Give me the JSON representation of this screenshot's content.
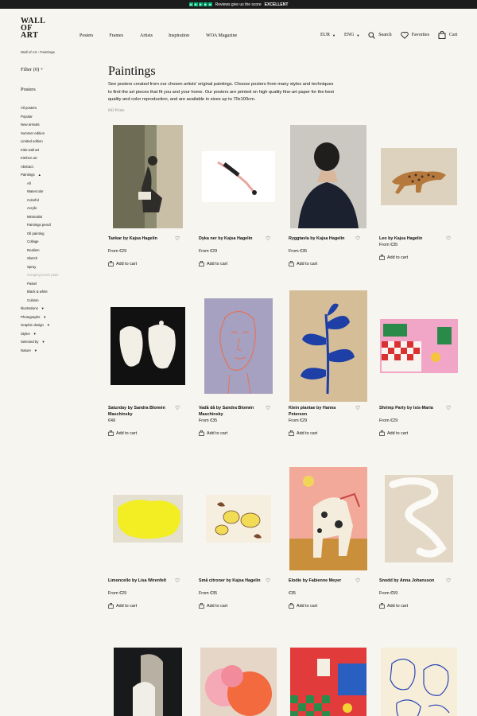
{
  "banner": {
    "text": "Reviews give us the score",
    "rating": "EXCELLENT"
  },
  "header": {
    "logo_lines": [
      "WALL",
      "OF",
      "ART"
    ],
    "nav": [
      "Posters",
      "Frames",
      "Artists",
      "Inspiration",
      "WOA Magazine"
    ],
    "currency": "EUR",
    "language": "ENG",
    "search_label": "Search",
    "favorites_label": "Favorites",
    "cart_label": "Cart"
  },
  "breadcrumb": {
    "home": "Wall of Art",
    "current": "Paintings"
  },
  "sidebar": {
    "filter_label": "Filter (0)",
    "section_title": "Posters",
    "items": [
      {
        "label": "All posters"
      },
      {
        "label": "Popular"
      },
      {
        "label": "New arrivals"
      },
      {
        "label": "Summer edition"
      },
      {
        "label": "Limited edition"
      },
      {
        "label": "Kids wall art"
      },
      {
        "label": "Kitchen art"
      },
      {
        "label": "Abstract"
      },
      {
        "label": "Paintings"
      },
      {
        "label": "All"
      },
      {
        "label": "Watercolor"
      },
      {
        "label": "Colorful"
      },
      {
        "label": "Acrylic"
      },
      {
        "label": "Minimalist"
      },
      {
        "label": "Paintings pencil"
      },
      {
        "label": "Oil painting"
      },
      {
        "label": "Collage"
      },
      {
        "label": "Realism"
      },
      {
        "label": "Sketch"
      },
      {
        "label": "Spray"
      },
      {
        "label": "Scraping brush paint"
      },
      {
        "label": "Pastel"
      },
      {
        "label": "Black & white"
      },
      {
        "label": "Cubism"
      },
      {
        "label": "Illustrations"
      },
      {
        "label": "Photographs"
      },
      {
        "label": "Graphic design"
      },
      {
        "label": "Styles"
      },
      {
        "label": "Selected by"
      },
      {
        "label": "Nature"
      }
    ]
  },
  "main": {
    "title": "Paintings",
    "description": "See posters created from our chosen artists' original paintings. Choose posters from many styles and techniques to find the art pieces that fit you and your home. Our posters are printed on high quality fine-art paper for the best quality and color reproduction, and are available in sizes up to 70x100cm.",
    "count": "603 Prints",
    "add_to_cart_label": "Add to cart",
    "products": [
      {
        "title": "Tankar by Kajsa Hagelin",
        "price": "From €29"
      },
      {
        "title": "Dyka ner by Kajsa Hagelin",
        "price": "From €29"
      },
      {
        "title": "Ryggtavla by Kajsa Hagelin",
        "price": "From €35"
      },
      {
        "title": "Leo by Kajsa Hagelin",
        "price": "From €35"
      },
      {
        "title": "Saturday by Sandra Blomén Maschinsky",
        "price": "€49"
      },
      {
        "title": "Vadå då by Sandra Blomén Maschinsky",
        "price": "From €35"
      },
      {
        "title": "Klein plantae by Hanna Peterson",
        "price": "From €29"
      },
      {
        "title": "Shrimp Party by Isis-Maria",
        "price": "From €29"
      },
      {
        "title": "Limoncello by Lisa Wirenfelt",
        "price": "From €29"
      },
      {
        "title": "Små citroner by Kajsa Hagelin",
        "price": "From €35"
      },
      {
        "title": "Elodie by Fabienne Meyer",
        "price": "€35"
      },
      {
        "title": "Snodd by Anna Johansson",
        "price": "From €59"
      },
      {
        "title": "",
        "price": ""
      },
      {
        "title": "",
        "price": ""
      },
      {
        "title": "",
        "price": ""
      },
      {
        "title": "",
        "price": ""
      }
    ]
  },
  "colors": {
    "background": "#f7f5f0",
    "banner": "#1c1c1c",
    "trustpilot_green": "#00b67a"
  }
}
